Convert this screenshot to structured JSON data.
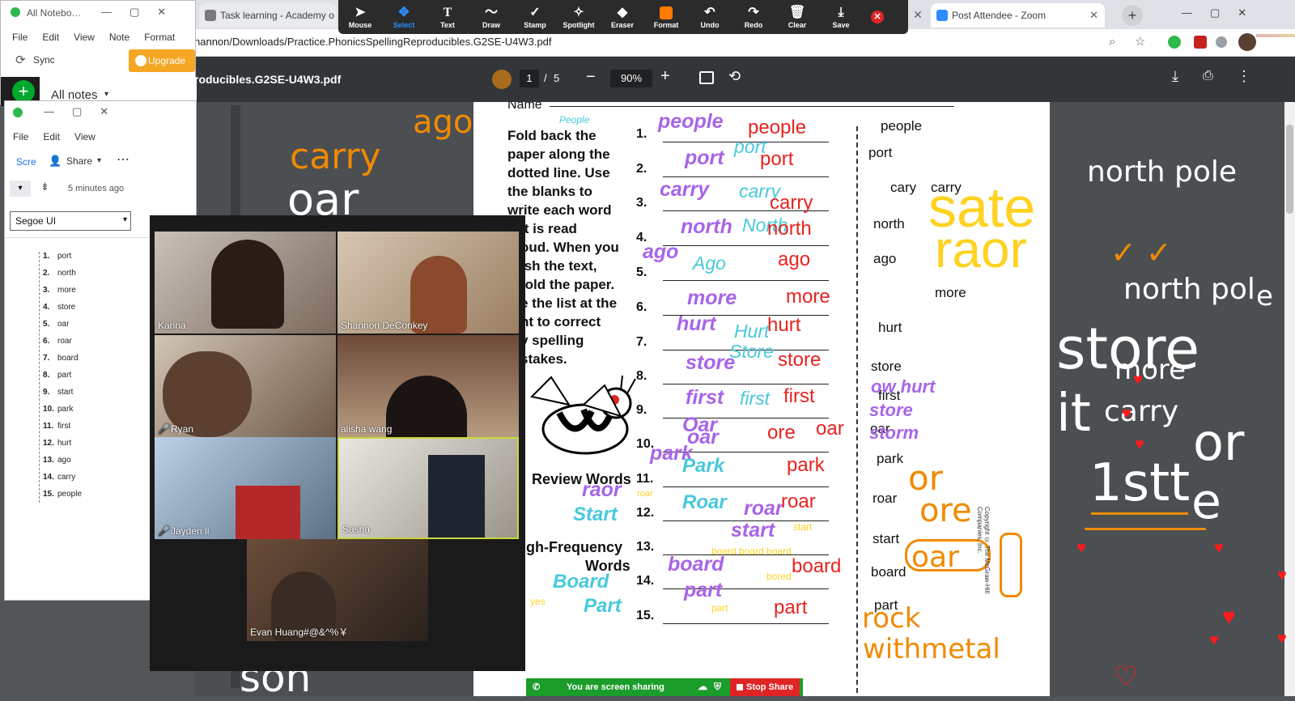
{
  "browser": {
    "tabs": [
      {
        "label": "All Notebo…"
      },
      {
        "label": "Task learning - Academy o"
      },
      {
        "label": "Post Attendee - Zoom"
      }
    ],
    "url": "hannon/Downloads/Practice.PhonicsSpellingReproducibles.G2SE-U4W3.pdf"
  },
  "annotation_toolbar": {
    "tools": [
      "Mouse",
      "Select",
      "Text",
      "Draw",
      "Stamp",
      "Spotlight",
      "Eraser",
      "Format",
      "Undo",
      "Redo",
      "Clear",
      "Save"
    ],
    "active_tool": "Select",
    "format_color": "#ff7a00"
  },
  "pdf_viewer": {
    "title": "roducibles.G2SE-U4W3.pdf",
    "page_current": "1",
    "page_sep": "/",
    "page_total": "5",
    "zoom": "90%"
  },
  "evernote_main": {
    "title": "All Notebo…",
    "menu": [
      "File",
      "Edit",
      "View",
      "Note",
      "Format"
    ],
    "sync_label": "Sync",
    "upgrade_label": "Upgrade",
    "all_notes_label": "All notes"
  },
  "evernote_note": {
    "menu": [
      "File",
      "Edit",
      "View"
    ],
    "share_label": "Share",
    "scre_label": "Scre",
    "last_edit": "5 minutes ago",
    "font_select": "Segoe UI",
    "numbers": [
      "1.",
      "2.",
      "3.",
      "4.",
      "5.",
      "6.",
      "7.",
      "8.",
      "9.",
      "10.",
      "11.",
      "12.",
      "13.",
      "14.",
      "15."
    ],
    "words": [
      "port",
      "north",
      "more",
      "store",
      "oar",
      "roar",
      "board",
      "part",
      "start",
      "park",
      "first",
      "hurt",
      "ago",
      "carry",
      "people"
    ]
  },
  "worksheet": {
    "name_label": "Name",
    "instructions": [
      "Fold back the",
      "paper along the",
      "dotted line. Use",
      "the blanks to",
      "write each word",
      "it is read",
      "oud. When you",
      "ish the text,",
      "fold the paper.",
      "e the list at the",
      "ht to correct",
      "y spelling",
      "stakes."
    ],
    "numbers": [
      "1.",
      "2.",
      "3.",
      "4.",
      "5.",
      "6.",
      "7.",
      "8.",
      "9.",
      "10.",
      "11.",
      "12.",
      "13.",
      "14.",
      "15."
    ],
    "review_label": "Review Words",
    "hf_label_1": "igh-Frequency",
    "hf_label_2": "Words",
    "answer_key": [
      "people",
      "port",
      "carry",
      "north",
      "ago",
      "more",
      "hurt",
      "store",
      "first",
      "oar",
      "park",
      "roar",
      "start",
      "board",
      "part"
    ],
    "copyright": "Copyright © The McGraw-Hill Companies, Inc."
  },
  "annotations_purple": [
    "people",
    "port",
    "carry",
    "north",
    "ago",
    "more",
    "hurt",
    "store",
    "first",
    "Oar",
    "oar",
    "park",
    "raor",
    "roar",
    "start",
    "board",
    "part",
    "ow hurt",
    "store",
    "storm"
  ],
  "annotations_cyan": [
    "People",
    "port",
    "carry",
    "North",
    "Ago",
    "Hurt",
    "Store",
    "first",
    "Park",
    "Start",
    "Roar",
    "Board",
    "Part"
  ],
  "annotations_red": [
    "people",
    "port",
    "carry",
    "north",
    "ago",
    "more",
    "hurt",
    "store",
    "first",
    "ore",
    "oar",
    "park",
    "roar",
    "board",
    "part"
  ],
  "annotations_orange": [
    "ago",
    "carry",
    "or",
    "ore",
    "oar",
    "rock",
    "withmetal"
  ],
  "annotations_yellow": [
    "sate",
    "raor",
    "roar",
    "start",
    "board board board",
    "bored",
    "part",
    "yes"
  ],
  "annotations_black": [
    "cary",
    "carry",
    "first",
    "oar"
  ],
  "annotations_white": [
    "north pole",
    "north pol",
    "e",
    "store",
    "more",
    "it",
    "carry",
    "or",
    "1stt",
    "e",
    "oar",
    "son"
  ],
  "zoom": {
    "participants": [
      {
        "name": "Karina",
        "muted": false
      },
      {
        "name": "Shannon DeConkey",
        "muted": false
      },
      {
        "name": "Ryan",
        "muted": true
      },
      {
        "name": "alisha wang",
        "muted": false
      },
      {
        "name": "Jayden ll",
        "muted": true
      },
      {
        "name": "Sasha",
        "muted": false
      },
      {
        "name": "Evan Huang#@&^%￥",
        "muted": false
      }
    ],
    "sharing_label": "You are screen sharing",
    "stop_share_label": "Stop Share"
  }
}
